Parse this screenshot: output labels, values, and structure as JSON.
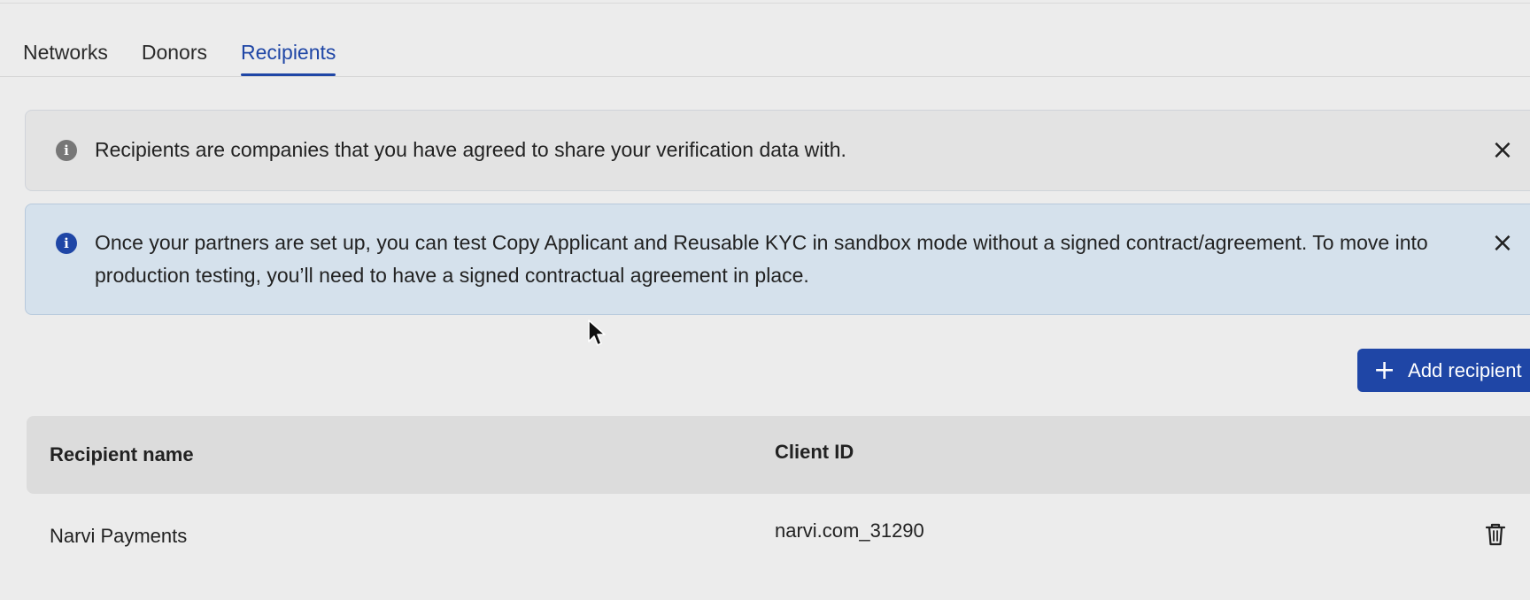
{
  "tabs": [
    {
      "label": "Networks",
      "active": false
    },
    {
      "label": "Donors",
      "active": false
    },
    {
      "label": "Recipients",
      "active": true
    }
  ],
  "banners": {
    "info": {
      "icon": "info-icon",
      "text": "Recipients are companies that you have agreed to share your verification data with."
    },
    "notice": {
      "icon": "info-icon",
      "text": "Once your partners are set up, you can test Copy Applicant and Reusable KYC in sandbox mode without a signed contract/agreement. To move into production testing, you’ll need to have a signed contractual agreement in place."
    }
  },
  "actions": {
    "add_recipient_label": "Add recipient"
  },
  "table": {
    "columns": [
      "Recipient name",
      "Client ID"
    ],
    "rows": [
      {
        "recipient_name": "Narvi Payments",
        "client_id": "narvi.com_31290"
      }
    ]
  },
  "colors": {
    "accent": "#1f46a6",
    "info_banner_bg": "#e3e3e3",
    "notice_banner_bg": "#d5e1ec",
    "page_bg": "#ececec"
  }
}
